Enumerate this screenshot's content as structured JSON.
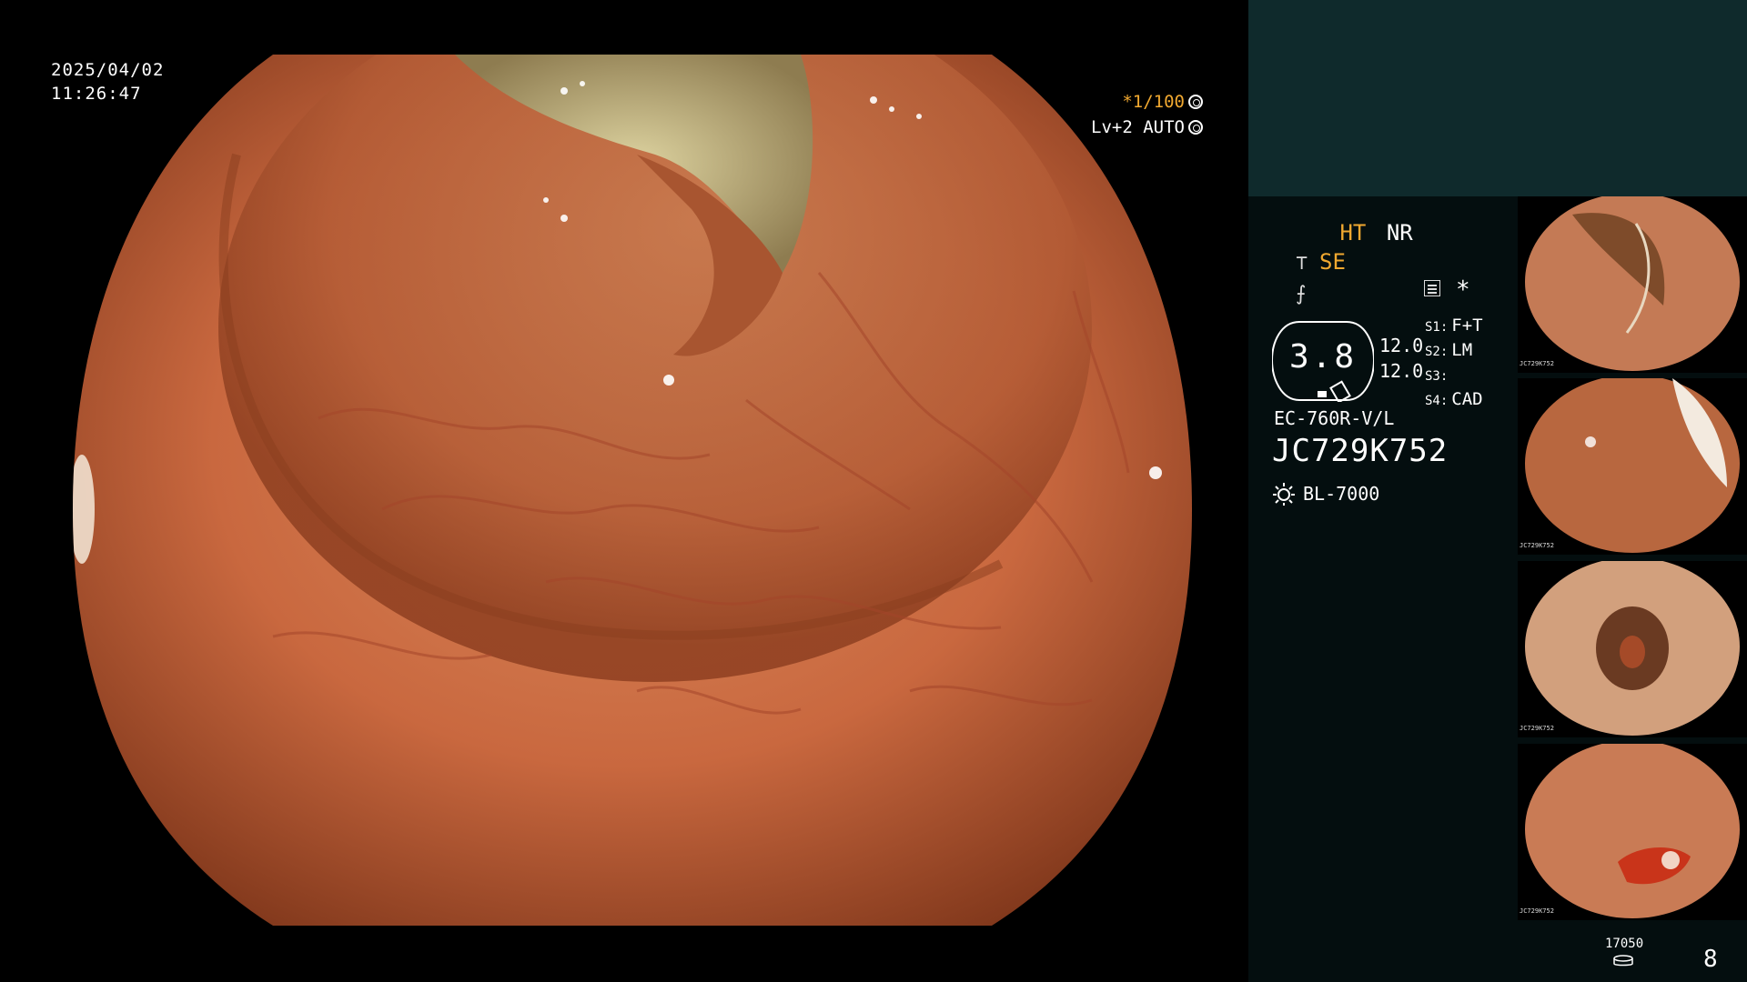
{
  "overlay": {
    "date": "2025/04/02",
    "time": "11:26:47",
    "shutter": "*1/100",
    "shutter_icon": "aperture-icon",
    "enhance": "Lv+2 AUTO",
    "enhance_icon": "iris-icon"
  },
  "panel": {
    "modes": {
      "ht": "HT",
      "nr": "NR",
      "se": "SE"
    },
    "gauge_value": "3.8",
    "gauge_top": "12.0",
    "gauge_bottom": "12.0",
    "slots": [
      {
        "key": "S1:",
        "value": "F+T"
      },
      {
        "key": "S2:",
        "value": "LM"
      },
      {
        "key": "S3:",
        "value": ""
      },
      {
        "key": "S4:",
        "value": "CAD"
      }
    ],
    "scope_model": "EC-760R-V/L",
    "serial": "JC729K752",
    "light_source": "BL-7000",
    "light_icon": "lamp-icon",
    "thumbnail_serial": "JC729K752",
    "counter": "17050",
    "counter_icon": "storage-icon",
    "page_number": "8"
  },
  "colors": {
    "accent_orange": "#f0a830",
    "panel_bg": "#040e0f",
    "panel_top": "#0f2a2c",
    "tissue": "#c2643e"
  }
}
